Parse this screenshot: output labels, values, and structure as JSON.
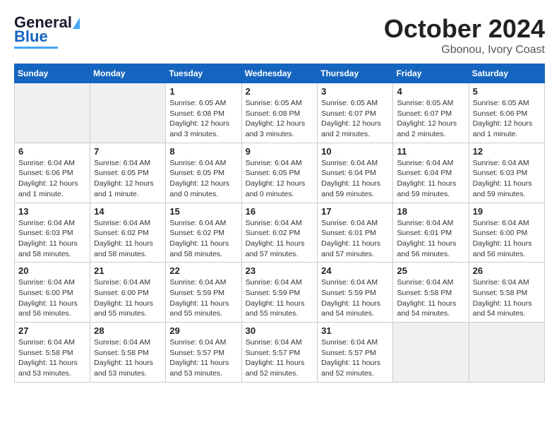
{
  "header": {
    "logo_line1": "General",
    "logo_line2": "Blue",
    "month_year": "October 2024",
    "location": "Gbonou, Ivory Coast"
  },
  "weekdays": [
    "Sunday",
    "Monday",
    "Tuesday",
    "Wednesday",
    "Thursday",
    "Friday",
    "Saturday"
  ],
  "weeks": [
    [
      {
        "day": "",
        "info": ""
      },
      {
        "day": "",
        "info": ""
      },
      {
        "day": "1",
        "info": "Sunrise: 6:05 AM\nSunset: 6:08 PM\nDaylight: 12 hours\nand 3 minutes."
      },
      {
        "day": "2",
        "info": "Sunrise: 6:05 AM\nSunset: 6:08 PM\nDaylight: 12 hours\nand 3 minutes."
      },
      {
        "day": "3",
        "info": "Sunrise: 6:05 AM\nSunset: 6:07 PM\nDaylight: 12 hours\nand 2 minutes."
      },
      {
        "day": "4",
        "info": "Sunrise: 6:05 AM\nSunset: 6:07 PM\nDaylight: 12 hours\nand 2 minutes."
      },
      {
        "day": "5",
        "info": "Sunrise: 6:05 AM\nSunset: 6:06 PM\nDaylight: 12 hours\nand 1 minute."
      }
    ],
    [
      {
        "day": "6",
        "info": "Sunrise: 6:04 AM\nSunset: 6:06 PM\nDaylight: 12 hours\nand 1 minute."
      },
      {
        "day": "7",
        "info": "Sunrise: 6:04 AM\nSunset: 6:05 PM\nDaylight: 12 hours\nand 1 minute."
      },
      {
        "day": "8",
        "info": "Sunrise: 6:04 AM\nSunset: 6:05 PM\nDaylight: 12 hours\nand 0 minutes."
      },
      {
        "day": "9",
        "info": "Sunrise: 6:04 AM\nSunset: 6:05 PM\nDaylight: 12 hours\nand 0 minutes."
      },
      {
        "day": "10",
        "info": "Sunrise: 6:04 AM\nSunset: 6:04 PM\nDaylight: 11 hours\nand 59 minutes."
      },
      {
        "day": "11",
        "info": "Sunrise: 6:04 AM\nSunset: 6:04 PM\nDaylight: 11 hours\nand 59 minutes."
      },
      {
        "day": "12",
        "info": "Sunrise: 6:04 AM\nSunset: 6:03 PM\nDaylight: 11 hours\nand 59 minutes."
      }
    ],
    [
      {
        "day": "13",
        "info": "Sunrise: 6:04 AM\nSunset: 6:03 PM\nDaylight: 11 hours\nand 58 minutes."
      },
      {
        "day": "14",
        "info": "Sunrise: 6:04 AM\nSunset: 6:02 PM\nDaylight: 11 hours\nand 58 minutes."
      },
      {
        "day": "15",
        "info": "Sunrise: 6:04 AM\nSunset: 6:02 PM\nDaylight: 11 hours\nand 58 minutes."
      },
      {
        "day": "16",
        "info": "Sunrise: 6:04 AM\nSunset: 6:02 PM\nDaylight: 11 hours\nand 57 minutes."
      },
      {
        "day": "17",
        "info": "Sunrise: 6:04 AM\nSunset: 6:01 PM\nDaylight: 11 hours\nand 57 minutes."
      },
      {
        "day": "18",
        "info": "Sunrise: 6:04 AM\nSunset: 6:01 PM\nDaylight: 11 hours\nand 56 minutes."
      },
      {
        "day": "19",
        "info": "Sunrise: 6:04 AM\nSunset: 6:00 PM\nDaylight: 11 hours\nand 56 minutes."
      }
    ],
    [
      {
        "day": "20",
        "info": "Sunrise: 6:04 AM\nSunset: 6:00 PM\nDaylight: 11 hours\nand 56 minutes."
      },
      {
        "day": "21",
        "info": "Sunrise: 6:04 AM\nSunset: 6:00 PM\nDaylight: 11 hours\nand 55 minutes."
      },
      {
        "day": "22",
        "info": "Sunrise: 6:04 AM\nSunset: 5:59 PM\nDaylight: 11 hours\nand 55 minutes."
      },
      {
        "day": "23",
        "info": "Sunrise: 6:04 AM\nSunset: 5:59 PM\nDaylight: 11 hours\nand 55 minutes."
      },
      {
        "day": "24",
        "info": "Sunrise: 6:04 AM\nSunset: 5:59 PM\nDaylight: 11 hours\nand 54 minutes."
      },
      {
        "day": "25",
        "info": "Sunrise: 6:04 AM\nSunset: 5:58 PM\nDaylight: 11 hours\nand 54 minutes."
      },
      {
        "day": "26",
        "info": "Sunrise: 6:04 AM\nSunset: 5:58 PM\nDaylight: 11 hours\nand 54 minutes."
      }
    ],
    [
      {
        "day": "27",
        "info": "Sunrise: 6:04 AM\nSunset: 5:58 PM\nDaylight: 11 hours\nand 53 minutes."
      },
      {
        "day": "28",
        "info": "Sunrise: 6:04 AM\nSunset: 5:58 PM\nDaylight: 11 hours\nand 53 minutes."
      },
      {
        "day": "29",
        "info": "Sunrise: 6:04 AM\nSunset: 5:57 PM\nDaylight: 11 hours\nand 53 minutes."
      },
      {
        "day": "30",
        "info": "Sunrise: 6:04 AM\nSunset: 5:57 PM\nDaylight: 11 hours\nand 52 minutes."
      },
      {
        "day": "31",
        "info": "Sunrise: 6:04 AM\nSunset: 5:57 PM\nDaylight: 11 hours\nand 52 minutes."
      },
      {
        "day": "",
        "info": ""
      },
      {
        "day": "",
        "info": ""
      }
    ]
  ]
}
